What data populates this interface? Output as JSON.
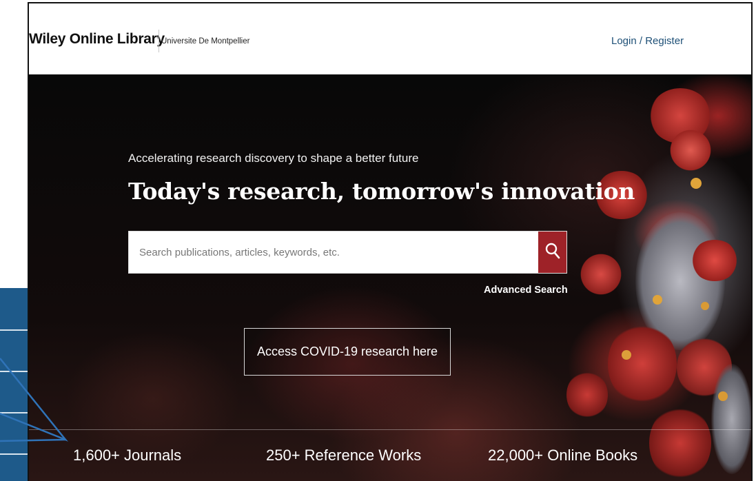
{
  "header": {
    "brand": "Wiley Online Library",
    "institution": "Universite De Montpellier",
    "login_label": "Login / Register"
  },
  "hero": {
    "tagline": "Accelerating research discovery to shape a better future",
    "headline": "Today's research, tomorrow's innovation",
    "search": {
      "placeholder": "Search publications, articles, keywords, etc.",
      "value": "",
      "button_icon": "search-icon"
    },
    "advanced_search_label": "Advanced Search",
    "covid_button_label": "Access COVID-19 research here"
  },
  "stats": [
    {
      "label": "1,600+ Journals"
    },
    {
      "label": "250+ Reference Works"
    },
    {
      "label": "22,000+ Online Books"
    }
  ],
  "colors": {
    "search_button": "#9e2228",
    "login_link": "#1d4f76",
    "annotation_arrow": "#2f73b8"
  }
}
